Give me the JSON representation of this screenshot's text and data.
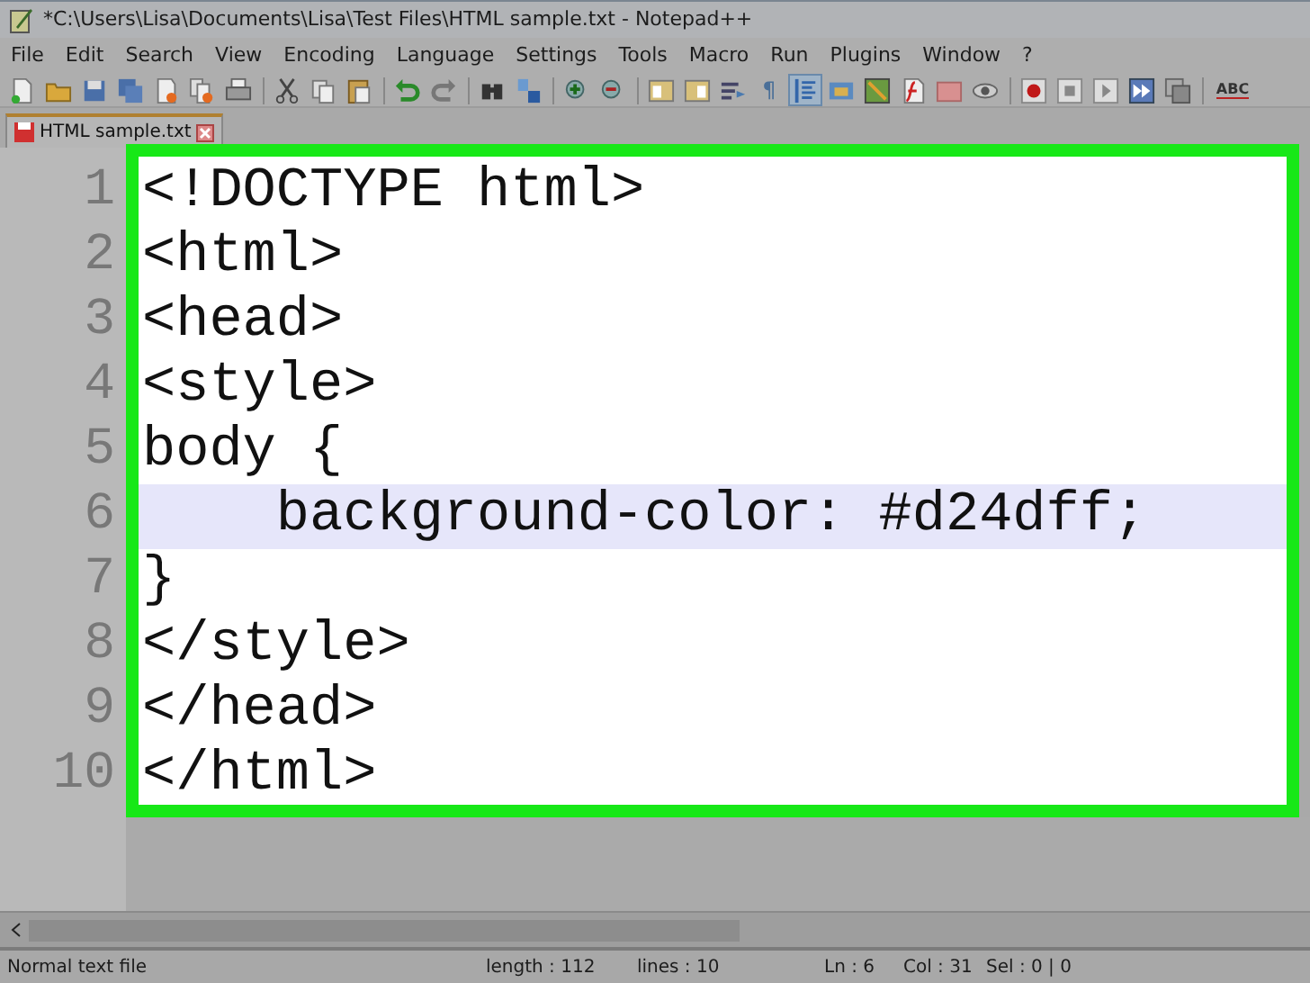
{
  "window": {
    "title": "*C:\\Users\\Lisa\\Documents\\Lisa\\Test Files\\HTML sample.txt - Notepad++"
  },
  "menu": [
    "File",
    "Edit",
    "Search",
    "View",
    "Encoding",
    "Language",
    "Settings",
    "Tools",
    "Macro",
    "Run",
    "Plugins",
    "Window",
    "?"
  ],
  "toolbar": [
    {
      "pressed": false
    },
    {
      "pressed": false
    },
    {
      "pressed": false
    },
    {
      "pressed": false
    },
    {
      "pressed": false
    },
    {
      "pressed": false
    },
    {
      "pressed": false
    },
    {
      "pressed": false
    },
    {
      "pressed": false
    },
    {
      "pressed": false
    },
    {
      "pressed": false
    },
    {
      "pressed": false
    },
    {
      "pressed": false
    },
    {
      "pressed": false
    },
    {
      "pressed": false
    },
    {
      "pressed": false
    },
    {
      "pressed": false
    },
    {
      "pressed": false
    },
    {
      "pressed": false
    },
    {
      "pressed": false,
      "label": "¶"
    },
    {
      "pressed": true
    },
    {
      "pressed": false
    },
    {
      "pressed": false
    },
    {
      "pressed": false
    },
    {
      "pressed": false
    },
    {
      "pressed": false
    },
    {
      "pressed": false
    },
    {
      "pressed": false
    },
    {
      "pressed": false
    },
    {
      "pressed": false
    },
    {
      "pressed": false
    },
    {
      "pressed": false,
      "label": "ABC"
    }
  ],
  "tabs": [
    {
      "label": "HTML sample.txt",
      "selected": true
    }
  ],
  "editor": {
    "lines": [
      {
        "number": "1",
        "text": "<!DOCTYPE html>",
        "current": false
      },
      {
        "number": "2",
        "text": "<html>",
        "current": false
      },
      {
        "number": "3",
        "text": "<head>",
        "current": false
      },
      {
        "number": "4",
        "text": "<style>",
        "current": false
      },
      {
        "number": "5",
        "text": "body {",
        "current": false
      },
      {
        "number": "6",
        "text": "    background-color: #d24dff;",
        "current": true
      },
      {
        "number": "7",
        "text": "}",
        "current": false
      },
      {
        "number": "8",
        "text": "</style>",
        "current": false
      },
      {
        "number": "9",
        "text": "</head>",
        "current": false
      },
      {
        "number": "10",
        "text": "</html>",
        "current": false
      }
    ]
  },
  "status_bar": {
    "type": "Normal text file",
    "length": "length : 112",
    "lines": "lines : 10",
    "line": "Ln : 6",
    "column": "Col : 31",
    "selection": "Sel : 0 | 0"
  }
}
